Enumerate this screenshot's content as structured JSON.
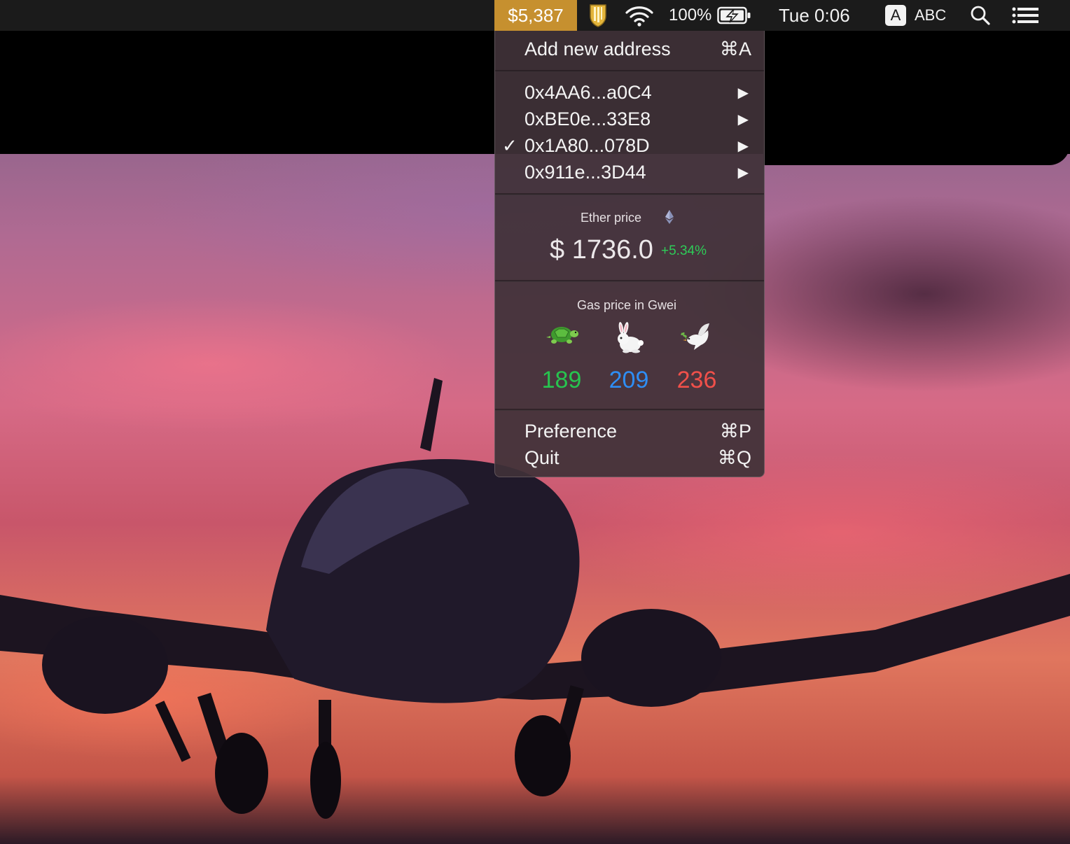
{
  "menubar": {
    "wallet_total": "$5,387",
    "battery_percent": "100%",
    "clock": "Tue 0:06",
    "input_source_badge": "A",
    "input_source_label": "ABC",
    "price_highlight_color": "#c6902f"
  },
  "menu": {
    "add_address": {
      "label": "Add new address",
      "shortcut": "⌘A"
    },
    "addresses": [
      {
        "label": "0x4AA6...a0C4",
        "checked": false
      },
      {
        "label": "0xBE0e...33E8",
        "checked": false
      },
      {
        "label": "0x1A80...078D",
        "checked": true
      },
      {
        "label": "0x911e...3D44",
        "checked": false
      }
    ],
    "check_mark": "✓",
    "submenu_arrow": "▶",
    "ether": {
      "title": "Ether price",
      "price": "$ 1736.0",
      "change": "+5.34%",
      "change_color": "#2ecc58"
    },
    "gas": {
      "title": "Gas price in Gwei",
      "tiers": [
        {
          "icon": "turtle-icon",
          "value": "189",
          "color": "#27c44f"
        },
        {
          "icon": "rabbit-icon",
          "value": "209",
          "color": "#2e8ef5"
        },
        {
          "icon": "dove-icon",
          "value": "236",
          "color": "#f0504a"
        }
      ]
    },
    "preference": {
      "label": "Preference",
      "shortcut": "⌘P"
    },
    "quit": {
      "label": "Quit",
      "shortcut": "⌘Q"
    }
  }
}
